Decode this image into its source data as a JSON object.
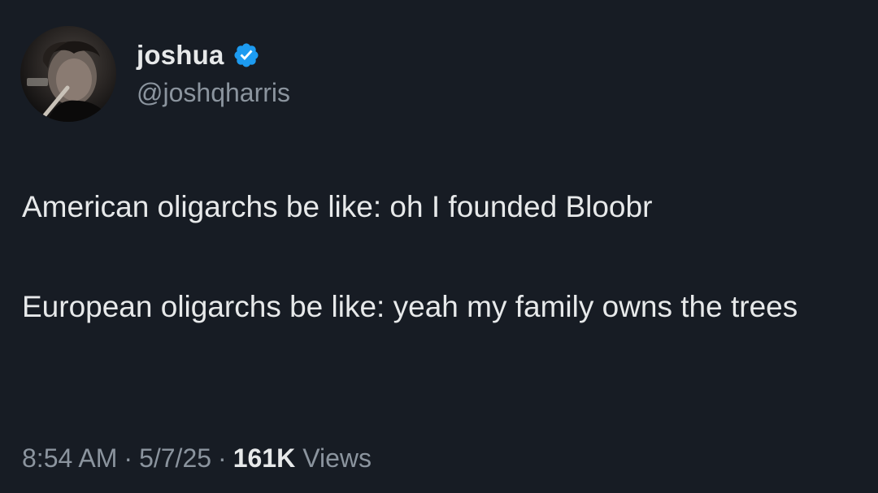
{
  "author": {
    "display_name": "joshua",
    "handle": "@joshqharris",
    "verified": true,
    "verified_color": "#1d9bf0",
    "avatar_icon": "profile-photo"
  },
  "tweet": {
    "paragraphs": [
      "American oligarchs be like: oh I founded Bloobr",
      "European oligarchs be like: yeah my family owns the trees"
    ]
  },
  "meta": {
    "time": "8:54 AM",
    "separator": "·",
    "date": "5/7/25",
    "views_count": "161K",
    "views_label": "Views"
  }
}
